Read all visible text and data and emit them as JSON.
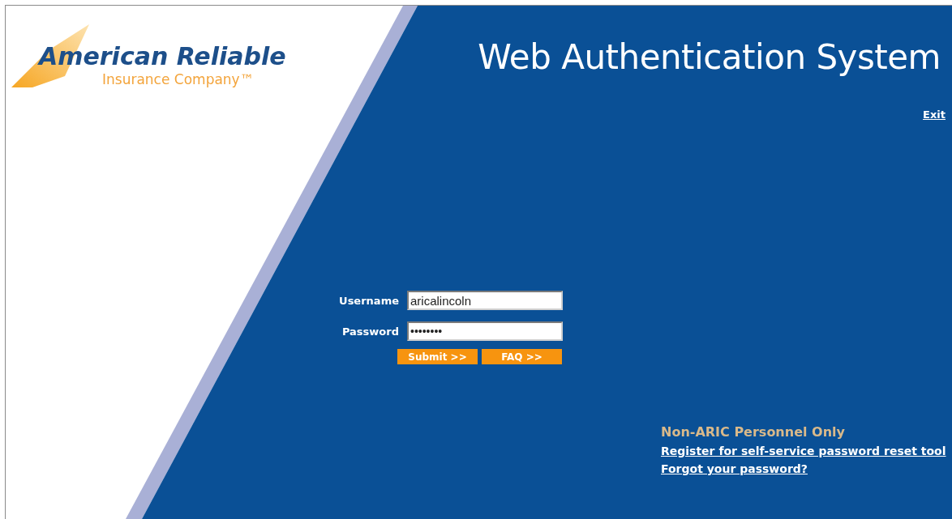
{
  "logo": {
    "name": "American Reliable",
    "tagline": "Insurance Company™"
  },
  "title": "Web Authentication System",
  "exit_link": "Exit",
  "login_form": {
    "fields": [
      {
        "label": "Username",
        "value": "aricalincoln"
      },
      {
        "label": "Password",
        "value": "••••••••"
      }
    ],
    "buttons": [
      "Submit >>",
      "FAQ >>"
    ]
  },
  "footer": {
    "heading": "Non-ARIC Personnel Only",
    "links": [
      "Register for self-service password reset tool",
      "Forgot your password?"
    ]
  }
}
